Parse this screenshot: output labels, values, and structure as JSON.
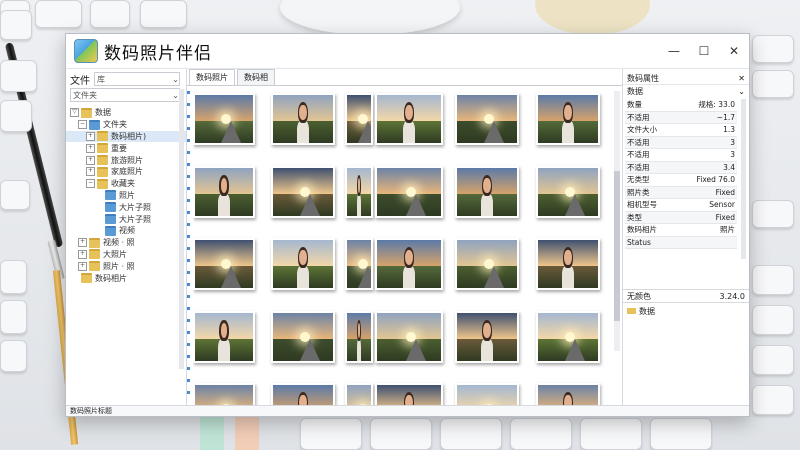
{
  "window": {
    "title": "数码照片伴侣",
    "controls": {
      "minimize": "—",
      "maximize": "☐",
      "close": "✕"
    }
  },
  "left_pane": {
    "label1": "文件",
    "input1": "库",
    "label2": "文件夹",
    "tree": [
      {
        "label": "数据",
        "level": 0,
        "expander": "▽",
        "folder": "yellow"
      },
      {
        "label": "文件夹",
        "level": 1,
        "expander": "−",
        "folder": "blue"
      },
      {
        "label": "数码相片)",
        "level": 2,
        "expander": "+",
        "folder": "yellow",
        "selected": true
      },
      {
        "label": "重要",
        "level": 2,
        "expander": "+",
        "folder": "yellow"
      },
      {
        "label": "旅游照片",
        "level": 2,
        "expander": "+",
        "folder": "yellow"
      },
      {
        "label": "家庭照片",
        "level": 2,
        "expander": "+",
        "folder": "yellow"
      },
      {
        "label": "收藏夹",
        "level": 2,
        "expander": "−",
        "folder": "yellow"
      },
      {
        "label": "照片",
        "level": 3,
        "expander": "",
        "folder": "blue"
      },
      {
        "label": "大片子照",
        "level": 3,
        "expander": "",
        "folder": "blue"
      },
      {
        "label": "大片子照",
        "level": 3,
        "expander": "",
        "folder": "blue"
      },
      {
        "label": "视频",
        "level": 3,
        "expander": "",
        "folder": "blue"
      },
      {
        "label": "视频 · 照",
        "level": 1,
        "expander": "+",
        "folder": "yellow"
      },
      {
        "label": "大照片",
        "level": 1,
        "expander": "+",
        "folder": "yellow"
      },
      {
        "label": "照片 · 照",
        "level": 1,
        "expander": "+",
        "folder": "yellow"
      },
      {
        "label": "数码相片",
        "level": 0,
        "expander": "",
        "folder": "yellow"
      }
    ]
  },
  "center": {
    "tabs": [
      {
        "label": "数码照片",
        "active": true
      },
      {
        "label": "数码相",
        "active": false
      }
    ]
  },
  "right_pane": {
    "header": "数码属性",
    "subheader": "数据",
    "properties": [
      {
        "key": "数量",
        "value": "规格: 33.0"
      },
      {
        "key": "不适用",
        "value": "~1.7"
      },
      {
        "key": "文件大小",
        "value": "1.3"
      },
      {
        "key": "不适用",
        "value": "3"
      },
      {
        "key": "不适用",
        "value": "3"
      },
      {
        "key": "不适用",
        "value": "3.4"
      },
      {
        "key": "无类型",
        "value": "Fixed 76.0"
      },
      {
        "key": "照片类",
        "value": "Fixed"
      },
      {
        "key": "相机型号",
        "value": "Sensor"
      },
      {
        "key": "类型",
        "value": "Fixed"
      },
      {
        "key": "数码相片",
        "value": "照片"
      },
      {
        "key": "Status",
        "value": ""
      }
    ],
    "footer_label": "无颜色",
    "footer_value": "3.24.0",
    "extra": "数据"
  },
  "status_bar": {
    "text": "数码照片标题"
  },
  "colors": {
    "accent": "#4a8bd0",
    "folder": "#e7c15a",
    "folder_blue": "#5b9bd5"
  }
}
